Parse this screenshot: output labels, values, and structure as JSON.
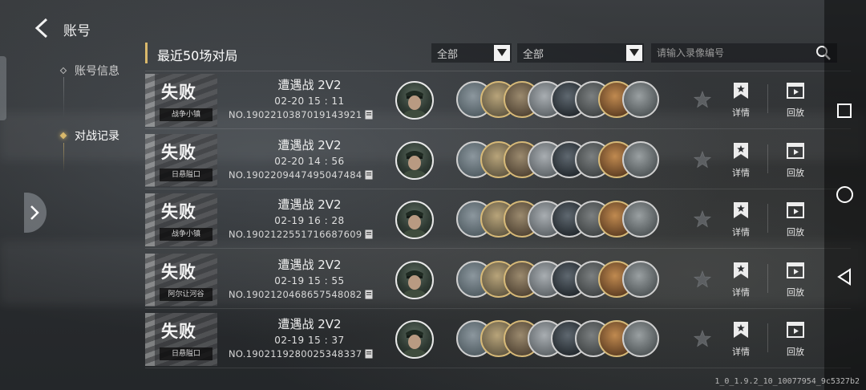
{
  "header": {
    "title": "账号"
  },
  "nav": [
    {
      "label": "账号信息",
      "active": false
    },
    {
      "label": "对战记录",
      "active": true
    }
  ],
  "section": {
    "title": "最近50场对局"
  },
  "filters": [
    {
      "value": "全部"
    },
    {
      "value": "全部"
    }
  ],
  "search": {
    "placeholder": "请输入录像编号"
  },
  "matches": [
    {
      "result": "失败",
      "map": "战争小镇",
      "mode": "遭遇战 2V2",
      "time": "02-20  15 : 11",
      "replay_no": "NO.1902210387019143921",
      "detail_label": "详情",
      "replay_label": "回放"
    },
    {
      "result": "失败",
      "map": "日悬隘口",
      "mode": "遭遇战 2V2",
      "time": "02-20  14 : 56",
      "replay_no": "NO.1902209447495047484",
      "detail_label": "详情",
      "replay_label": "回放"
    },
    {
      "result": "失败",
      "map": "战争小镇",
      "mode": "遭遇战 2V2",
      "time": "02-19  16 : 28",
      "replay_no": "NO.1902122551716687609",
      "detail_label": "详情",
      "replay_label": "回放"
    },
    {
      "result": "失败",
      "map": "阿尔让河谷",
      "mode": "遭遇战 2V2",
      "time": "02-19  15 : 55",
      "replay_no": "NO.1902120468657548082",
      "detail_label": "详情",
      "replay_label": "回放"
    },
    {
      "result": "失败",
      "map": "日悬隘口",
      "mode": "遭遇战 2V2",
      "time": "02-19  15 : 37",
      "replay_no": "NO.1902119280025348337",
      "detail_label": "详情",
      "replay_label": "回放"
    }
  ],
  "unit_icons": [
    "tank-unit-icon",
    "infantry-unit-icon",
    "soldier-unit-icon",
    "armored-car-unit-icon",
    "aircraft-unit-icon",
    "artillery-unit-icon",
    "explosion-unit-icon",
    "heavy-tank-unit-icon"
  ],
  "version": "1_0_1.9.2_10_10077954_9c5327b2",
  "colors": {
    "accent": "#d9b86b",
    "text": "#f0f0f0"
  }
}
